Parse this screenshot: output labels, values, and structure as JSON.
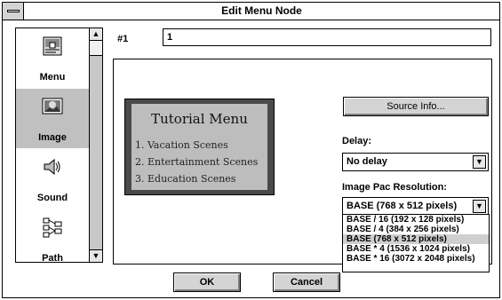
{
  "window": {
    "title": "Edit Menu Node"
  },
  "sidebar": {
    "items": [
      {
        "label": "Menu",
        "icon": "menu-icon",
        "selected": false
      },
      {
        "label": "Image",
        "icon": "image-icon",
        "selected": true
      },
      {
        "label": "Sound",
        "icon": "sound-icon",
        "selected": false
      },
      {
        "label": "Path",
        "icon": "path-icon",
        "selected": false
      }
    ]
  },
  "node": {
    "number_label": "#1",
    "number_value": "1"
  },
  "preview": {
    "title": "Tutorial Menu",
    "lines": [
      "1.  Vacation Scenes",
      "2.  Entertainment Scenes",
      "3.  Education Scenes"
    ]
  },
  "source_info_label": "Source Info...",
  "delay": {
    "label": "Delay:",
    "value": "No delay"
  },
  "resolution": {
    "label": "Image Pac Resolution:",
    "value": "BASE (768 x 512 pixels)",
    "options": [
      "BASE / 16 (192 x 128 pixels)",
      "BASE / 4 (384 x 256 pixels)",
      "BASE (768 x 512 pixels)",
      "BASE * 4 (1536 x 1024 pixels)",
      "BASE * 16 (3072 x 2048 pixels)"
    ],
    "selected_index": 2
  },
  "buttons": {
    "ok": "OK",
    "cancel": "Cancel"
  }
}
